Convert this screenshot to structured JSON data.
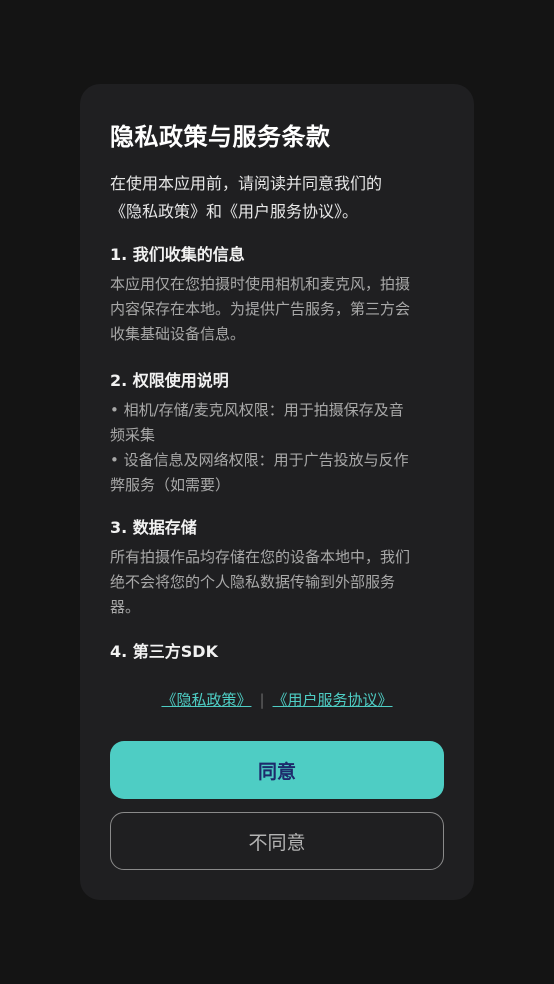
{
  "dialog": {
    "title": "隐私政策与服务条款",
    "intro": {
      "line1": "在使用本应用前，请阅读并同意我们的",
      "line2": "《隐私政策》和《用户服务协议》。"
    },
    "sections": [
      {
        "heading": "1. 我们收集的信息",
        "lines": [
          "本应用仅在您拍摄时使用相机和麦克风，拍摄",
          "内容保存在本地。为提供广告服务，第三方会",
          "收集基础设备信息。"
        ]
      },
      {
        "heading": "2. 权限使用说明",
        "lines": [
          "• 相机/存储/麦克风权限：用于拍摄保存及音",
          "频采集",
          "• 设备信息及网络权限：用于广告投放与反作",
          "弊服务（如需要）"
        ]
      },
      {
        "heading": "3. 数据存储",
        "lines": [
          "所有拍摄作品均存储在您的设备本地中，我们",
          "绝不会将您的个人隐私数据传输到外部服务",
          "器。"
        ]
      },
      {
        "heading": "4. 第三方SDK",
        "lines": []
      }
    ],
    "links": {
      "privacy_policy": "《隐私政策》",
      "separator": "|",
      "user_agreement": "《用户服务协议》"
    },
    "buttons": {
      "agree": "同意",
      "disagree": "不同意"
    }
  },
  "colors": {
    "background": "#141414",
    "card": "#1f1f21",
    "accent": "#4ecdc4",
    "agree_text": "#1d2a6b"
  }
}
